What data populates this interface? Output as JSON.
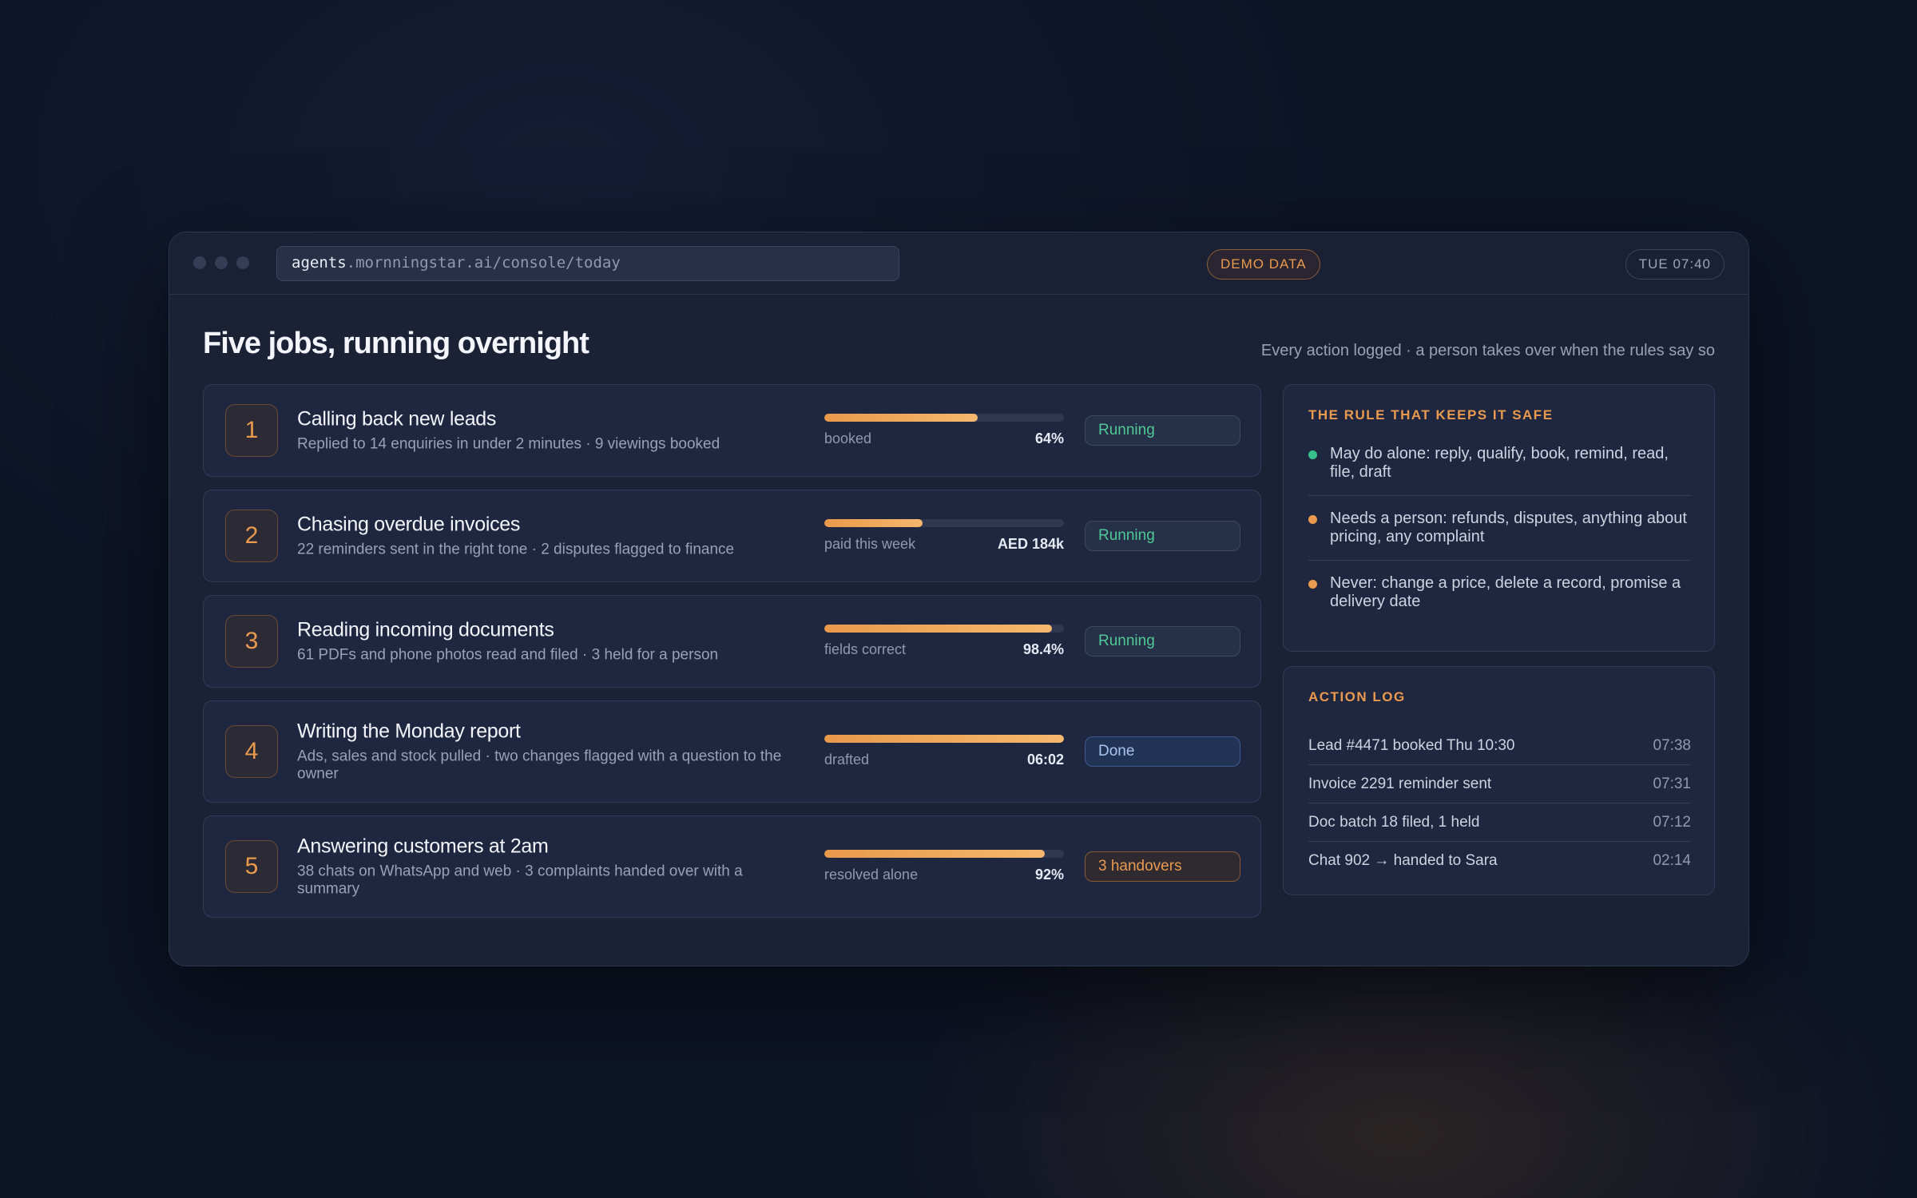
{
  "browser": {
    "url_host": "agents",
    "url_rest": ".mornningstar.ai/console/today",
    "badge": "DEMO DATA",
    "clock": "TUE 07:40"
  },
  "header": {
    "title": "Five jobs, running overnight",
    "subtitle": "Every action logged · a person takes over when the rules say so"
  },
  "jobs": [
    {
      "num": "1",
      "title": "Calling back new leads",
      "desc": "Replied to 14 enquiries in under 2 minutes · 9 viewings booked",
      "metric_label": "booked",
      "metric_value": "64%",
      "progress": 0.64,
      "status": "Running",
      "status_type": "running"
    },
    {
      "num": "2",
      "title": "Chasing overdue invoices",
      "desc": "22 reminders sent in the right tone · 2 disputes flagged to finance",
      "metric_label": "paid this week",
      "metric_value": "AED 184k",
      "progress": 0.41,
      "status": "Running",
      "status_type": "running"
    },
    {
      "num": "3",
      "title": "Reading incoming documents",
      "desc": "61 PDFs and phone photos read and filed · 3 held for a person",
      "metric_label": "fields correct",
      "metric_value": "98.4%",
      "progress": 0.95,
      "status": "Running",
      "status_type": "running"
    },
    {
      "num": "4",
      "title": "Writing the Monday report",
      "desc": "Ads, sales and stock pulled · two changes flagged with a question to the owner",
      "metric_label": "drafted",
      "metric_value": "06:02",
      "progress": 1.0,
      "status": "Done",
      "status_type": "done"
    },
    {
      "num": "5",
      "title": "Answering customers at 2am",
      "desc": "38 chats on WhatsApp and web · 3 complaints handed over with a summary",
      "metric_label": "resolved alone",
      "metric_value": "92%",
      "progress": 0.92,
      "status": "3 handovers",
      "status_type": "handover"
    }
  ],
  "rules": {
    "heading": "THE RULE THAT KEEPS IT SAFE",
    "items": [
      {
        "text": "May do alone: reply, qualify, book, remind, read, file, draft",
        "color": "#36c18a"
      },
      {
        "text": "Needs a person: refunds, disputes, anything about pricing, any complaint",
        "color": "#e99a4e"
      },
      {
        "text": "Never: change a price, delete a record, promise a delivery date",
        "color": "#e99a4e"
      }
    ]
  },
  "log": {
    "heading": "ACTION LOG",
    "items": [
      {
        "text": "Lead #4471 booked Thu 10:30",
        "time": "07:38"
      },
      {
        "text": "Invoice 2291 reminder sent",
        "time": "07:31"
      },
      {
        "text": "Doc batch 18 filed, 1 held",
        "time": "07:12"
      },
      {
        "text": "Chat 902 → handed to Sara",
        "time": "02:14"
      }
    ]
  }
}
